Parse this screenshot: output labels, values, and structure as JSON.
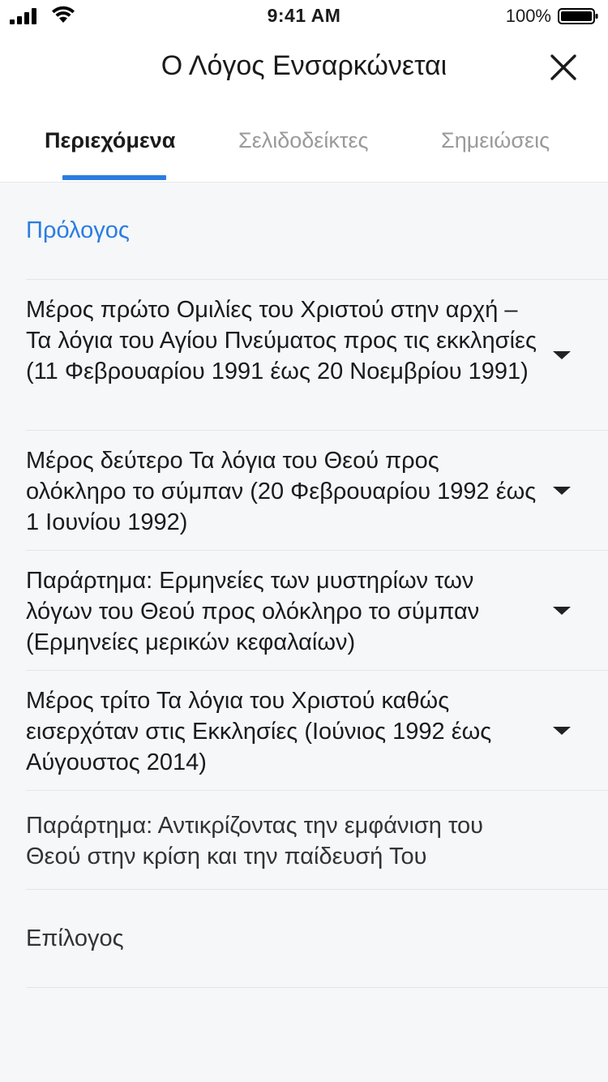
{
  "status_bar": {
    "time": "9:41 AM",
    "battery_percent": "100%"
  },
  "header": {
    "title": "Ο Λόγος Ενσαρκώνεται",
    "close_icon": "close-icon"
  },
  "tabs": [
    {
      "label": "Περιεχόμενα",
      "active": true
    },
    {
      "label": "Σελιδοδείκτες",
      "active": false
    },
    {
      "label": "Σημειώσεις",
      "active": false
    }
  ],
  "contents": [
    {
      "label": "Πρόλογος",
      "expandable": false
    },
    {
      "label": "Μέρος πρώτο Ομιλίες του Χριστού στην αρχή – Τα λόγια του Αγίου Πνεύματος προς τις εκκλησίες (11 Φεβρουαρίου 1991 έως 20 Νοεμβρίου 1991)",
      "expandable": true
    },
    {
      "label": "Μέρος δεύτερο Τα λόγια του Θεού προς ολόκληρο το σύμπαν (20 Φεβρουαρίου 1992 έως 1 Ιουνίου 1992)",
      "expandable": true
    },
    {
      "label": "Παράρτημα: Ερμηνείες των μυστηρίων των λόγων του Θεού προς ολόκληρο το σύμπαν (Ερμηνείες μερικών κεφαλαίων)",
      "expandable": true
    },
    {
      "label": "Μέρος τρίτο Τα λόγια του Χριστού καθώς εισερχόταν στις Εκκλησίες (Ιούνιος 1992 έως Αύγουστος 2014)",
      "expandable": true
    },
    {
      "label": "Παράρτημα: Αντικρίζοντας την εμφάνιση του Θεού στην κρίση και την παίδευσή Του",
      "expandable": false
    },
    {
      "label": "Επίλογος",
      "expandable": false
    }
  ],
  "colors": {
    "accent": "#2a7de1",
    "background": "#f5f7f9",
    "header_background": "#ffffff",
    "inactive_tab": "#9a9a9a"
  }
}
